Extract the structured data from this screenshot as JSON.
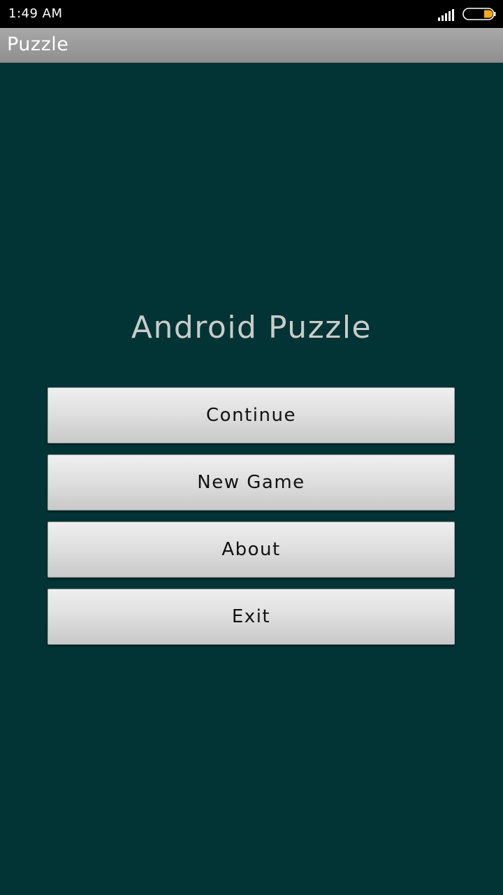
{
  "status_bar": {
    "time": "1:49 AM",
    "signal_icon": "signal-bars-icon",
    "battery_icon": "battery-icon",
    "battery_color": "#f5a623"
  },
  "action_bar": {
    "title": "Puzzle"
  },
  "main": {
    "heading": "Android Puzzle",
    "buttons": [
      {
        "label": "Continue"
      },
      {
        "label": "New Game"
      },
      {
        "label": "About"
      },
      {
        "label": "Exit"
      }
    ]
  },
  "colors": {
    "background": "#023436",
    "heading_text": "#c8ccc8",
    "button_text": "#111111"
  }
}
